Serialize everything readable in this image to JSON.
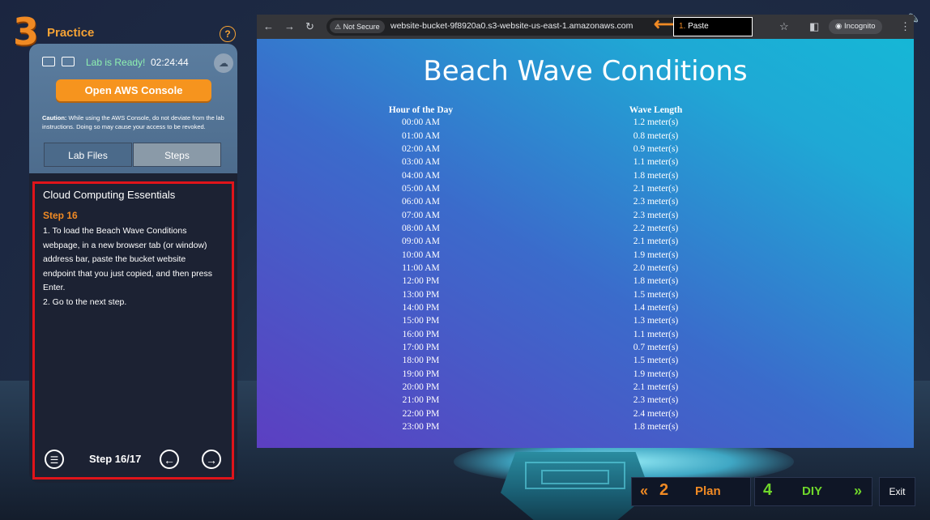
{
  "practice": {
    "number": "3",
    "label": "Practice",
    "help": "?"
  },
  "lab": {
    "status": "Lab is Ready!",
    "timer": "02:24:44",
    "console_button": "Open AWS Console",
    "caution_label": "Caution:",
    "caution_text": "While using the AWS Console, do not deviate from the lab instructions. Doing so may cause your access to be revoked.",
    "tabs": [
      "Lab Files",
      "Steps"
    ]
  },
  "steps": {
    "course_title": "Cloud Computing Essentials",
    "step_title": "Step 16",
    "line1": "1. To load the Beach Wave Conditions webpage, in a new browser tab (or window) address bar, paste the bucket website endpoint that you just copied, and then press Enter.",
    "line2": "2. Go to the next step.",
    "counter": "Step 16/17"
  },
  "browser": {
    "not_secure": "Not Secure",
    "url": "website-bucket-9f8920a0.s3-website-us-east-1.amazonaws.com",
    "annotation_num": "1.",
    "annotation_text": "Paste",
    "incognito": "Incognito"
  },
  "page": {
    "title": "Beach Wave Conditions",
    "col1": "Hour of the Day",
    "col2": "Wave Length",
    "rows": [
      [
        "00:00 AM",
        "1.2 meter(s)"
      ],
      [
        "01:00 AM",
        "0.8 meter(s)"
      ],
      [
        "02:00 AM",
        "0.9 meter(s)"
      ],
      [
        "03:00 AM",
        "1.1 meter(s)"
      ],
      [
        "04:00 AM",
        "1.8 meter(s)"
      ],
      [
        "05:00 AM",
        "2.1 meter(s)"
      ],
      [
        "06:00 AM",
        "2.3 meter(s)"
      ],
      [
        "07:00 AM",
        "2.3 meter(s)"
      ],
      [
        "08:00 AM",
        "2.2 meter(s)"
      ],
      [
        "09:00 AM",
        "2.1 meter(s)"
      ],
      [
        "10:00 AM",
        "1.9 meter(s)"
      ],
      [
        "11:00 AM",
        "2.0 meter(s)"
      ],
      [
        "12:00 PM",
        "1.8 meter(s)"
      ],
      [
        "13:00 PM",
        "1.5 meter(s)"
      ],
      [
        "14:00 PM",
        "1.4 meter(s)"
      ],
      [
        "15:00 PM",
        "1.3 meter(s)"
      ],
      [
        "16:00 PM",
        "1.1 meter(s)"
      ],
      [
        "17:00 PM",
        "0.7 meter(s)"
      ],
      [
        "18:00 PM",
        "1.5 meter(s)"
      ],
      [
        "19:00 PM",
        "1.9 meter(s)"
      ],
      [
        "20:00 PM",
        "2.1 meter(s)"
      ],
      [
        "21:00 PM",
        "2.3 meter(s)"
      ],
      [
        "22:00 PM",
        "2.4 meter(s)"
      ],
      [
        "23:00 PM",
        "1.8 meter(s)"
      ]
    ]
  },
  "nav": {
    "plan_num": "2",
    "plan_label": "Plan",
    "diy_num": "4",
    "diy_label": "DIY",
    "exit_label": "Exit"
  },
  "colors": {
    "accent": "#f08a24",
    "green": "#6fd62b",
    "highlight": "#e0141a"
  }
}
